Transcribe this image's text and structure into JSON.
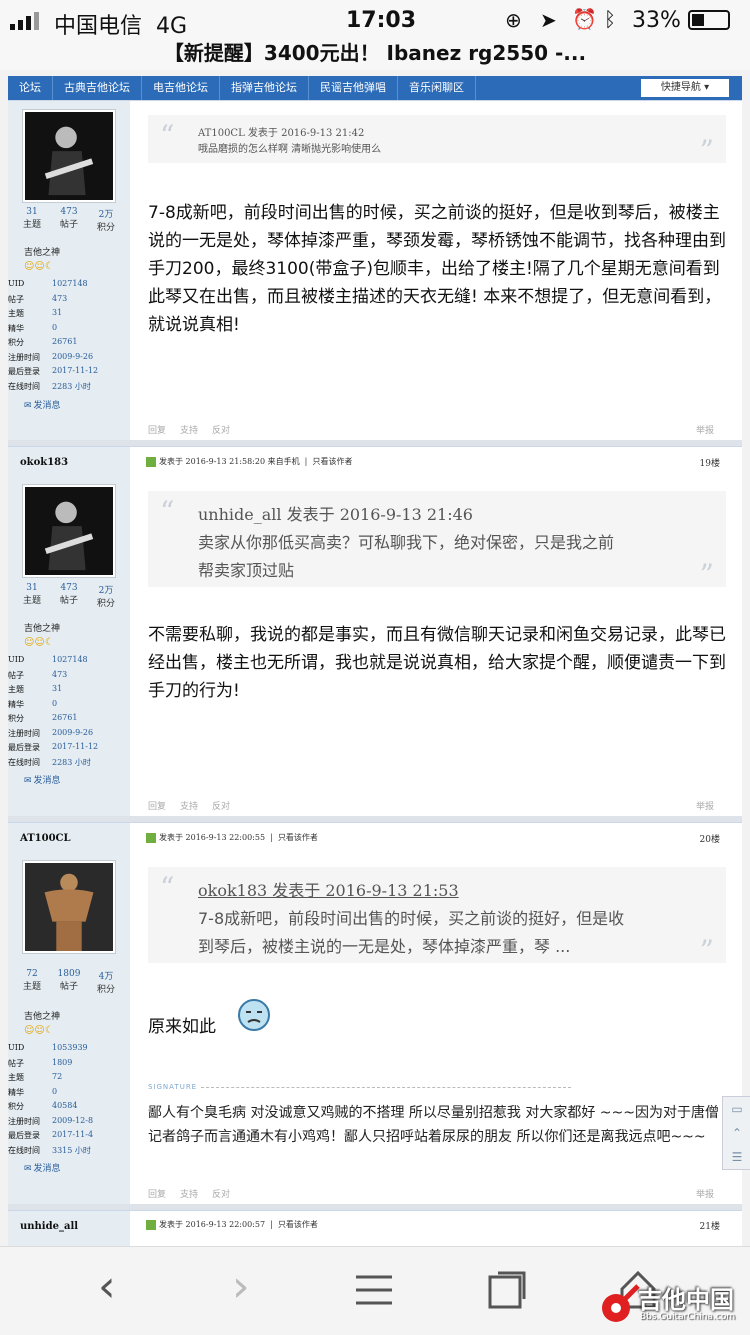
{
  "status_bar": {
    "carrier": "中国电信",
    "network": "4G",
    "time": "17:03",
    "battery": "33%"
  },
  "page_title": "【新提醒】3400元出！ Ibanez rg2550 -...",
  "forum_nav": {
    "items": [
      "论坛",
      "古典吉他论坛",
      "电吉他论坛",
      "指弹吉他论坛",
      "民谣吉他弹唱",
      "音乐闲聊区"
    ],
    "quick_nav": "快捷导航 ▾"
  },
  "posts": [
    {
      "user": {
        "stats": [
          {
            "value": "31",
            "label": "主题"
          },
          {
            "value": "473",
            "label": "帖子"
          },
          {
            "value": "2万",
            "label": "积分"
          }
        ],
        "rank": "吉他之神",
        "info": [
          {
            "k": "UID",
            "v": "1027148"
          },
          {
            "k": "帖子",
            "v": "473"
          },
          {
            "k": "主题",
            "v": "31"
          },
          {
            "k": "精华",
            "v": "0"
          },
          {
            "k": "积分",
            "v": "26761"
          },
          {
            "k": "注册时间",
            "v": "2009-9-26"
          },
          {
            "k": "最后登录",
            "v": "2017-11-12"
          },
          {
            "k": "在线时间",
            "v": "2283 小时"
          }
        ],
        "message": "发消息"
      },
      "quote": {
        "author": "AT100CL 发表于 2016-9-13 21:42",
        "text": "哦品磨损的怎么样啊 清晰抛光影响使用么"
      },
      "content": "7-8成新吧，前段时间出售的时候，买之前谈的挺好，但是收到琴后，被楼主说的一无是处，琴体掉漆严重，琴颈发霉，琴桥锈蚀不能调节，找各种理由到手刀200，最终3100(带盒子)包顺丰，出给了楼主!隔了几个星期无意间看到此琴又在出售，而且被楼主描述的天衣无缝! 本来不想提了，但无意间看到，就说说真相!",
      "actions": [
        "回复",
        "支持",
        "反对"
      ],
      "report": "举报"
    },
    {
      "user": {
        "name": "okok183",
        "stats": [
          {
            "value": "31",
            "label": "主题"
          },
          {
            "value": "473",
            "label": "帖子"
          },
          {
            "value": "2万",
            "label": "积分"
          }
        ],
        "rank": "吉他之神",
        "info": [
          {
            "k": "UID",
            "v": "1027148"
          },
          {
            "k": "帖子",
            "v": "473"
          },
          {
            "k": "主题",
            "v": "31"
          },
          {
            "k": "精华",
            "v": "0"
          },
          {
            "k": "积分",
            "v": "26761"
          },
          {
            "k": "注册时间",
            "v": "2009-9-26"
          },
          {
            "k": "最后登录",
            "v": "2017-11-12"
          },
          {
            "k": "在线时间",
            "v": "2283 小时"
          }
        ],
        "message": "发消息"
      },
      "header": {
        "posted": "发表于 2016-9-13 21:58:20 来自手机",
        "only_author": "只看该作者",
        "floor": "19楼"
      },
      "quote": {
        "author": "unhide_all 发表于 2016-9-13 21:46",
        "text_line1": "卖家从你那低买高卖？可私聊我下，绝对保密，只是我之前",
        "text_line2": "帮卖家顶过贴"
      },
      "content": "不需要私聊，我说的都是事实，而且有微信聊天记录和闲鱼交易记录，此琴已经出售，楼主也无所谓，我也就是说说真相，给大家提个醒，顺便谴责一下到手刀的行为!",
      "actions": [
        "回复",
        "支持",
        "反对"
      ],
      "report": "举报"
    },
    {
      "user": {
        "name": "AT100CL",
        "stats": [
          {
            "value": "72",
            "label": "主题"
          },
          {
            "value": "1809",
            "label": "帖子"
          },
          {
            "value": "4万",
            "label": "积分"
          }
        ],
        "rank": "吉他之神",
        "info": [
          {
            "k": "UID",
            "v": "1053939"
          },
          {
            "k": "帖子",
            "v": "1809"
          },
          {
            "k": "主题",
            "v": "72"
          },
          {
            "k": "精华",
            "v": "0"
          },
          {
            "k": "积分",
            "v": "40584"
          },
          {
            "k": "注册时间",
            "v": "2009-12-8"
          },
          {
            "k": "最后登录",
            "v": "2017-11-4"
          },
          {
            "k": "在线时间",
            "v": "3315 小时"
          }
        ],
        "message": "发消息"
      },
      "header": {
        "posted": "发表于 2016-9-13 22:00:55",
        "only_author": "只看该作者",
        "floor": "20楼"
      },
      "quote": {
        "author": "okok183 发表于 2016-9-13 21:53",
        "text_line1": "7-8成新吧，前段时间出售的时候，买之前谈的挺好，但是收",
        "text_line2": "到琴后，被楼主说的一无是处，琴体掉漆严重，琴 ..."
      },
      "content": "原来如此",
      "signature_label": "SIGNATURE",
      "signature": "鄙人有个臭毛病 对没诚意又鸡贼的不搭理 所以尽量别招惹我 对大家都好  ~~~因为对于唐僧记者鸽子而言通通木有小鸡鸡！鄙人只招呼站着尿尿的朋友 所以你们还是离我远点吧~~~",
      "actions": [
        "回复",
        "支持",
        "反对"
      ],
      "report": "举报"
    },
    {
      "user": {
        "name": "unhide_all"
      },
      "header": {
        "posted": "发表于 2016-9-13 22:00:57",
        "only_author": "只看该作者",
        "floor": "21楼"
      }
    }
  ],
  "watermark": {
    "brand": "吉他中国",
    "url": "Bbs.GuitarChina.com"
  },
  "colors": {
    "nav_blue": "#2b6bb8",
    "sidebar_bg": "#e5edf2",
    "link_blue": "#2a5d9a"
  }
}
